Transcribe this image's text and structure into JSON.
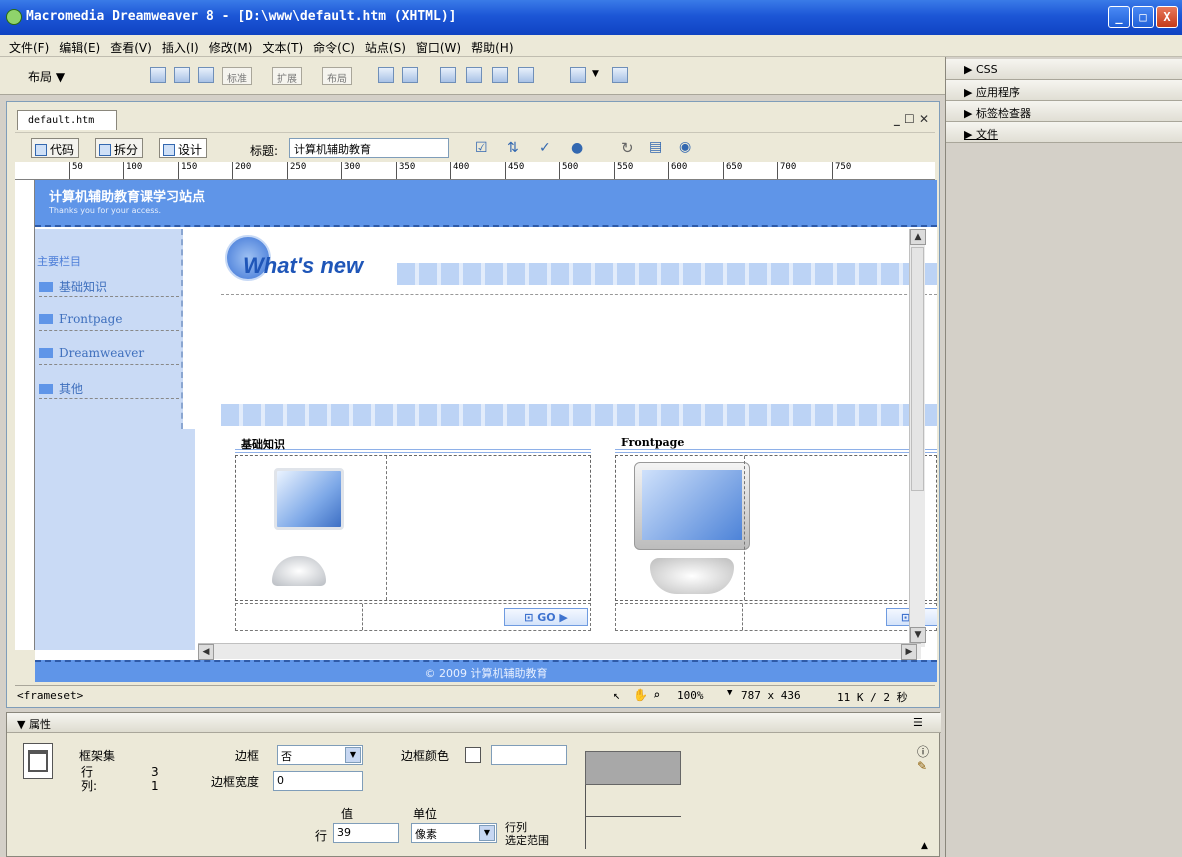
{
  "window": {
    "title": "Macromedia Dreamweaver 8 - [D:\\www\\default.htm (XHTML)]",
    "min_label": "_",
    "max_label": "□",
    "close_label": "X"
  },
  "menu": {
    "items": [
      "文件(F)",
      "编辑(E)",
      "查看(V)",
      "插入(I)",
      "修改(M)",
      "文本(T)",
      "命令(C)",
      "站点(S)",
      "窗口(W)",
      "帮助(H)"
    ]
  },
  "insert_bar": {
    "category": "布局 ▼",
    "mode_labels": [
      "标准",
      "扩展",
      "布局"
    ]
  },
  "right_panels": [
    "▶ CSS",
    "▶ 应用程序",
    "▶ 标签检查器",
    "▶ 文件"
  ],
  "document": {
    "tab": "default.htm",
    "window_controls": "_ ☐ ✕",
    "views": {
      "code": "代码",
      "split": "拆分",
      "design": "设计"
    },
    "title_label": "标题:",
    "title_value": "计算机辅助教育"
  },
  "ruler": {
    "ticks": [
      "50",
      "100",
      "150",
      "200",
      "250",
      "300",
      "350",
      "400",
      "450",
      "500",
      "550",
      "600",
      "650",
      "700",
      "750"
    ]
  },
  "site": {
    "header_title": "计算机辅助教育课学习站点",
    "header_sub": "Thanks you for your access.",
    "nav_title": "主要栏目",
    "nav_items": [
      "基础知识",
      "Frontpage",
      "Dreamweaver",
      "其他"
    ],
    "whats_new": "What's new",
    "section1": "基础知识",
    "section2": "Frontpage",
    "go_label": "GO ▶",
    "go_label_cut": "G",
    "footer": "© 2009 计算机辅助教育"
  },
  "status": {
    "tag": "<frameset>",
    "zoom": "100%",
    "size": "787 x 436",
    "file": "11 K / 2 秒"
  },
  "properties": {
    "title": "▼ 属性",
    "type": "框架集",
    "rows_label": "行",
    "rows_value": "3",
    "cols_label": "列:",
    "cols_value": "1",
    "border_label": "边框",
    "border_value": "否",
    "border_color_label": "边框颜色",
    "border_width_label": "边框宽度",
    "border_width_value": "0",
    "value_header": "值",
    "unit_header": "单位",
    "row_label": "行",
    "row_value": "39",
    "unit_value": "像素",
    "rowcol_label1": "行列",
    "rowcol_label2": "选定范围"
  }
}
